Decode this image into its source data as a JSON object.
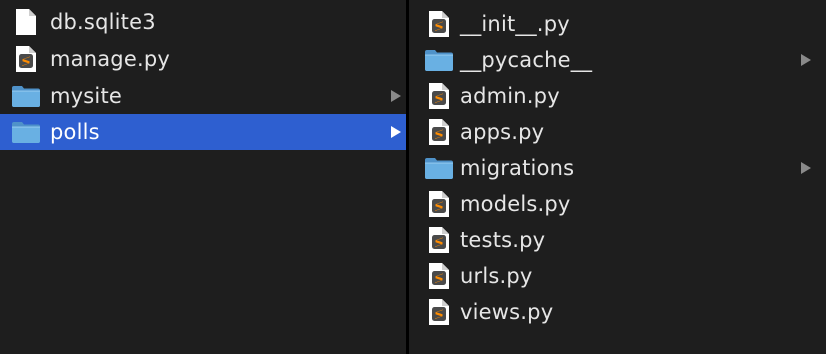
{
  "colors": {
    "background": "#1e1e1e",
    "selection": "#2e5fd0",
    "text": "#e6e6e6",
    "folder": "#64a8dc",
    "sublime_badge": "#ff8c00"
  },
  "left_column": {
    "items": [
      {
        "label": "db.sqlite3",
        "icon": "blank-file-icon",
        "type": "file"
      },
      {
        "label": "manage.py",
        "icon": "python-file-icon",
        "type": "file"
      },
      {
        "label": "mysite",
        "icon": "folder-icon",
        "type": "folder"
      },
      {
        "label": "polls",
        "icon": "folder-icon",
        "type": "folder",
        "selected": true
      }
    ]
  },
  "right_column": {
    "items": [
      {
        "label": "__init__.py",
        "icon": "python-file-icon",
        "type": "file"
      },
      {
        "label": "__pycache__",
        "icon": "folder-icon",
        "type": "folder"
      },
      {
        "label": "admin.py",
        "icon": "python-file-icon",
        "type": "file"
      },
      {
        "label": "apps.py",
        "icon": "python-file-icon",
        "type": "file"
      },
      {
        "label": "migrations",
        "icon": "folder-icon",
        "type": "folder"
      },
      {
        "label": "models.py",
        "icon": "python-file-icon",
        "type": "file"
      },
      {
        "label": "tests.py",
        "icon": "python-file-icon",
        "type": "file"
      },
      {
        "label": "urls.py",
        "icon": "python-file-icon",
        "type": "file"
      },
      {
        "label": "views.py",
        "icon": "python-file-icon",
        "type": "file"
      }
    ]
  }
}
